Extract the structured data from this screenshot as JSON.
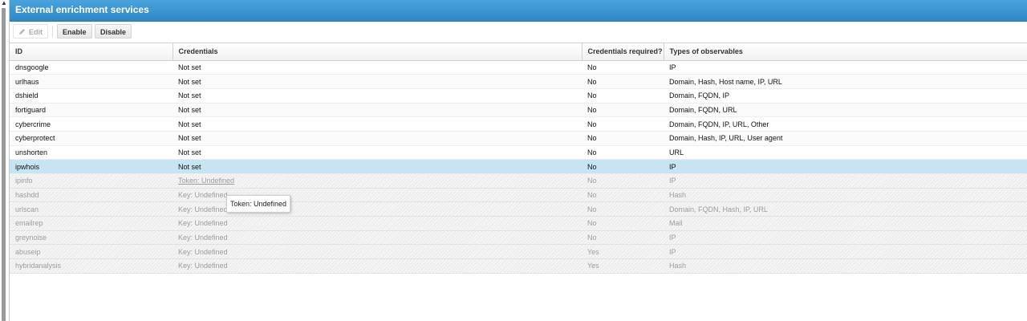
{
  "panel": {
    "title": "External enrichment services"
  },
  "toolbar": {
    "edit_label": "Edit",
    "enable_label": "Enable",
    "disable_label": "Disable"
  },
  "columns": [
    "ID",
    "Credentials",
    "Credentials required?",
    "Types of observables"
  ],
  "rows": [
    {
      "id": "dnsgoogle",
      "credentials": "Not set",
      "required": "No",
      "types": "IP",
      "state": "normal"
    },
    {
      "id": "urlhaus",
      "credentials": "Not set",
      "required": "No",
      "types": "Domain, Hash, Host name, IP, URL",
      "state": "even"
    },
    {
      "id": "dshield",
      "credentials": "Not set",
      "required": "No",
      "types": "Domain, FQDN, IP",
      "state": "normal"
    },
    {
      "id": "fortiguard",
      "credentials": "Not set",
      "required": "No",
      "types": "Domain, FQDN, URL",
      "state": "even"
    },
    {
      "id": "cybercrime",
      "credentials": "Not set",
      "required": "No",
      "types": "Domain, FQDN, IP, URL, Other",
      "state": "normal"
    },
    {
      "id": "cyberprotect",
      "credentials": "Not set",
      "required": "No",
      "types": "Domain, Hash, IP, URL, User agent",
      "state": "even"
    },
    {
      "id": "unshorten",
      "credentials": "Not set",
      "required": "No",
      "types": "URL",
      "state": "normal"
    },
    {
      "id": "ipwhois",
      "credentials": "Not set",
      "required": "No",
      "types": "IP",
      "state": "selected"
    },
    {
      "id": "ipinfo",
      "credentials": "Token: Undefined",
      "required": "No",
      "types": "IP",
      "state": "disabled-link"
    },
    {
      "id": "hashdd",
      "credentials": "Key: Undefined",
      "required": "No",
      "types": "Hash",
      "state": "disabled"
    },
    {
      "id": "urlscan",
      "credentials": "Key: Undefined",
      "required": "No",
      "types": "Domain, FQDN, Hash, IP, URL",
      "state": "disabled"
    },
    {
      "id": "emailrep",
      "credentials": "Key: Undefined",
      "required": "No",
      "types": "Mail",
      "state": "disabled"
    },
    {
      "id": "greynoise",
      "credentials": "Key: Undefined",
      "required": "No",
      "types": "IP",
      "state": "disabled"
    },
    {
      "id": "abuseip",
      "credentials": "Key: Undefined",
      "required": "Yes",
      "types": "IP",
      "state": "disabled"
    },
    {
      "id": "hybridanalysis",
      "credentials": "Key: Undefined",
      "required": "Yes",
      "types": "Hash",
      "state": "disabled"
    }
  ],
  "tooltip": {
    "text": "Token: Undefined"
  },
  "colors": {
    "header_blue": "#2f87c6",
    "selected_row": "#c6e4f2"
  }
}
